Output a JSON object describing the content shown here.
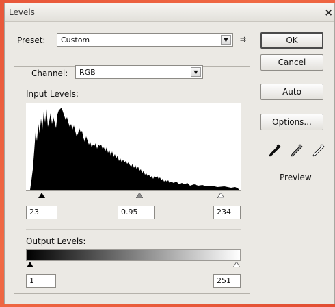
{
  "dialog": {
    "title": "Levels",
    "close": "×"
  },
  "preset": {
    "label": "Preset:",
    "value": "Custom",
    "menu_glyph": "⇉"
  },
  "channel": {
    "label": "Channel:",
    "value": "RGB"
  },
  "input_levels": {
    "label": "Input Levels:",
    "black": "23",
    "gamma": "0.95",
    "white": "234"
  },
  "output_levels": {
    "label": "Output Levels:",
    "black": "1",
    "white": "251"
  },
  "buttons": {
    "ok": "OK",
    "cancel": "Cancel",
    "auto": "Auto",
    "options": "Options..."
  },
  "preview": {
    "label": "Preview"
  },
  "icons": {
    "black_eyedropper": "eyedropper-black-icon",
    "gray_eyedropper": "eyedropper-gray-icon",
    "white_eyedropper": "eyedropper-white-icon"
  }
}
